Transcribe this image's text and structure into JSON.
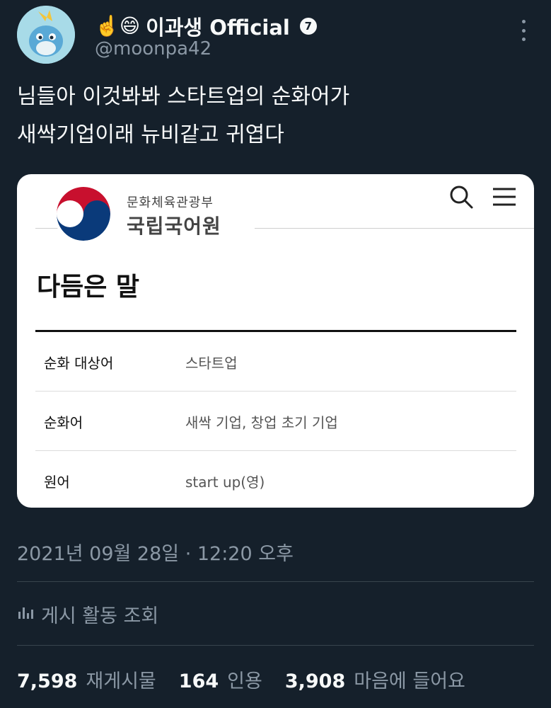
{
  "author": {
    "emoji_prefix": "☝️😄",
    "display_name": "이과생 Official",
    "badge": "7",
    "handle": "@moonpa42"
  },
  "tweet": {
    "line1": "님들아 이것봐봐 스타트업의 순화어가",
    "line2": "새싹기업이래 뉴비같고 귀엽다"
  },
  "card": {
    "org_small": "문화체육관광부",
    "org_big": "국립국어원",
    "title": "다듬은 말",
    "rows": [
      {
        "label": "순화 대상어",
        "value": "스타트업"
      },
      {
        "label": "순화어",
        "value": "새싹 기업, 창업 초기 기업"
      },
      {
        "label": "원어",
        "value": "start up(영)"
      }
    ],
    "colors": {
      "emblem_red": "#c8102e",
      "emblem_blue": "#0a3a7a"
    }
  },
  "meta": {
    "timestamp": "2021년 09월 28일 · 12:20 오후",
    "views_label": "게시 활동 조회"
  },
  "stats": {
    "retweets_num": "7,598",
    "retweets_label": "재게시물",
    "quotes_num": "164",
    "quotes_label": "인용",
    "likes_num": "3,908",
    "likes_label": "마음에 들어요"
  }
}
